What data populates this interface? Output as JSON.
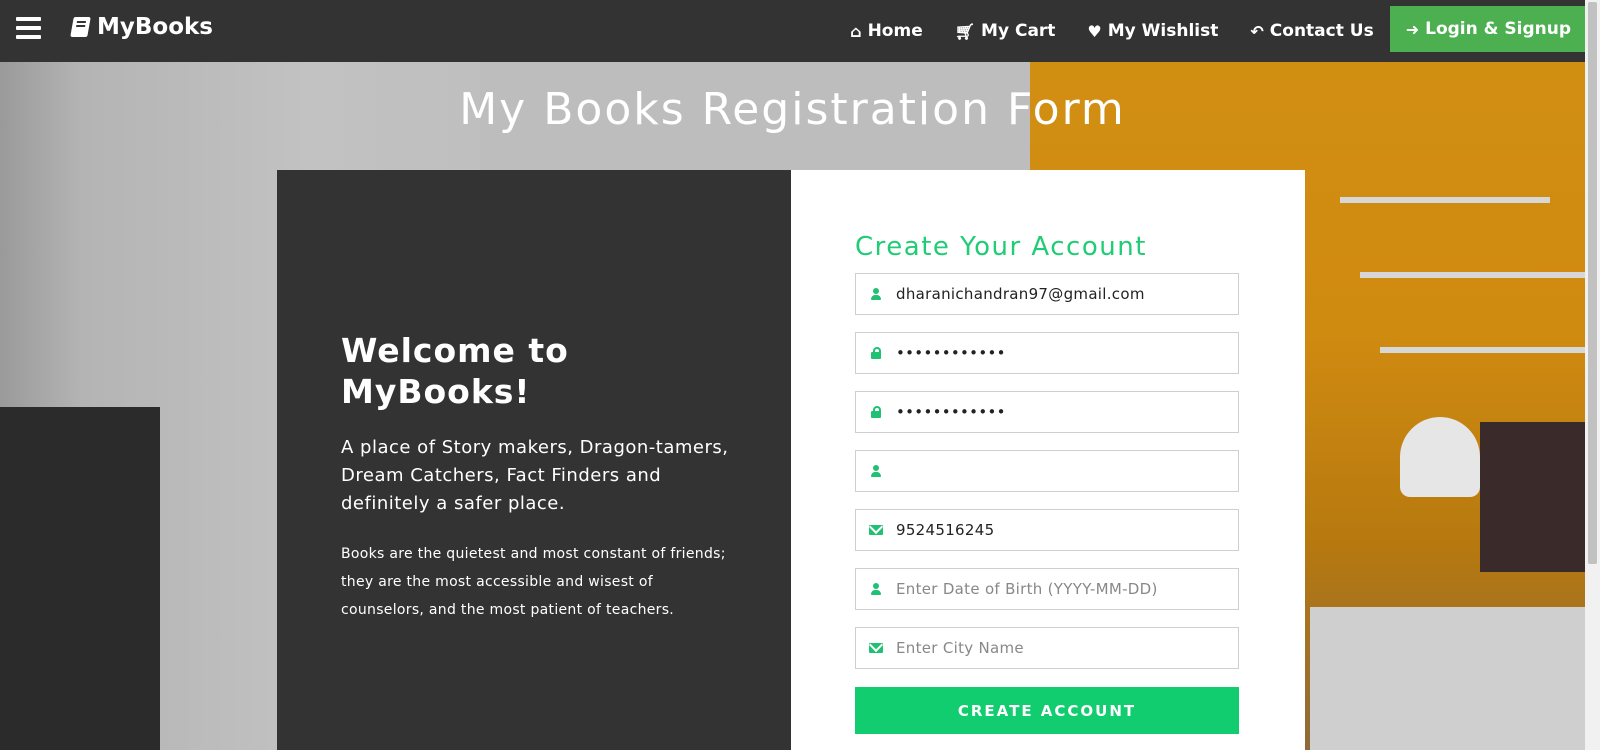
{
  "nav": {
    "brand": "MyBooks",
    "links": [
      {
        "label": "Home",
        "icon": "home-icon"
      },
      {
        "label": "My Cart",
        "icon": "cart-icon"
      },
      {
        "label": "My Wishlist",
        "icon": "heart-icon"
      },
      {
        "label": "Contact Us",
        "icon": "reply-icon"
      }
    ],
    "login_label": "Login & Signup",
    "login_color": "#4caf50"
  },
  "page": {
    "title": "My Books Registration Form"
  },
  "welcome": {
    "heading": "Welcome to MyBooks!",
    "tagline": "A place of Story makers, Dragon-tamers, Dream Catchers, Fact Finders and definitely a safer place.",
    "quote": "Books are the quietest and most constant of friends; they are the most accessible and wisest of counselors, and the most patient of teachers."
  },
  "form": {
    "title": "Create Your Account",
    "accent": "#12cd6f",
    "fields": [
      {
        "icon": "user-icon",
        "value": "dharanichandran97@gmail.com",
        "placeholder": ""
      },
      {
        "icon": "lock-icon",
        "value": "••••••••••••",
        "placeholder": ""
      },
      {
        "icon": "lock-icon",
        "value": "••••••••••••",
        "placeholder": ""
      },
      {
        "icon": "user-icon",
        "value": "",
        "placeholder": ""
      },
      {
        "icon": "mail-icon",
        "value": "9524516245",
        "placeholder": ""
      },
      {
        "icon": "user-icon",
        "value": "",
        "placeholder": "Enter Date of Birth (YYYY-MM-DD)"
      },
      {
        "icon": "mail-icon",
        "value": "",
        "placeholder": "Enter City Name"
      }
    ],
    "submit_label": "CREATE ACCOUNT"
  }
}
